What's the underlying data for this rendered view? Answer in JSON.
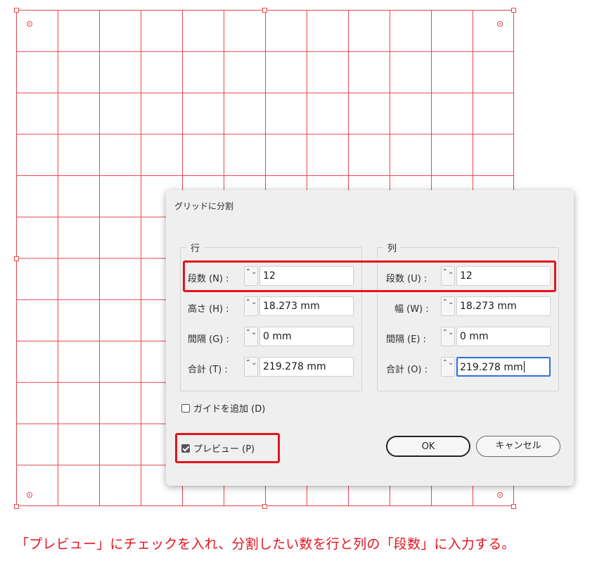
{
  "dialog": {
    "title": "グリッドに分割",
    "rows_group": {
      "label": "行",
      "fields": [
        {
          "label": "段数 (N) :",
          "value": "12"
        },
        {
          "label": "高さ (H) :",
          "value": "18.273 mm"
        },
        {
          "label": "間隔 (G) :",
          "value": "0 mm"
        },
        {
          "label": "合計 (T) :",
          "value": "219.278 mm"
        }
      ]
    },
    "cols_group": {
      "label": "列",
      "fields": [
        {
          "label": "段数 (U) :",
          "value": "12"
        },
        {
          "label": "幅 (W) :",
          "value": "18.273 mm"
        },
        {
          "label": "間隔 (E) :",
          "value": "0 mm"
        },
        {
          "label": "合計 (O) :",
          "value": "219.278 mm"
        }
      ]
    },
    "add_guides": {
      "label": "ガイドを追加 (D)",
      "checked": false
    },
    "preview": {
      "label": "プレビュー (P)",
      "checked": true
    },
    "ok_label": "OK",
    "cancel_label": "キャンセル",
    "stepper_glyph": "⌃⌄"
  },
  "caption": "「プレビュー」にチェックを入れ、分割したい数を行と列の「段数」に入力する。",
  "colors": {
    "grid_line": "#e8474d",
    "highlight": "#e4141e",
    "caption": "#e4141e",
    "focus": "#2d73d6",
    "dialog_bg": "#efefef"
  },
  "grid": {
    "rows": 12,
    "columns": 12
  }
}
